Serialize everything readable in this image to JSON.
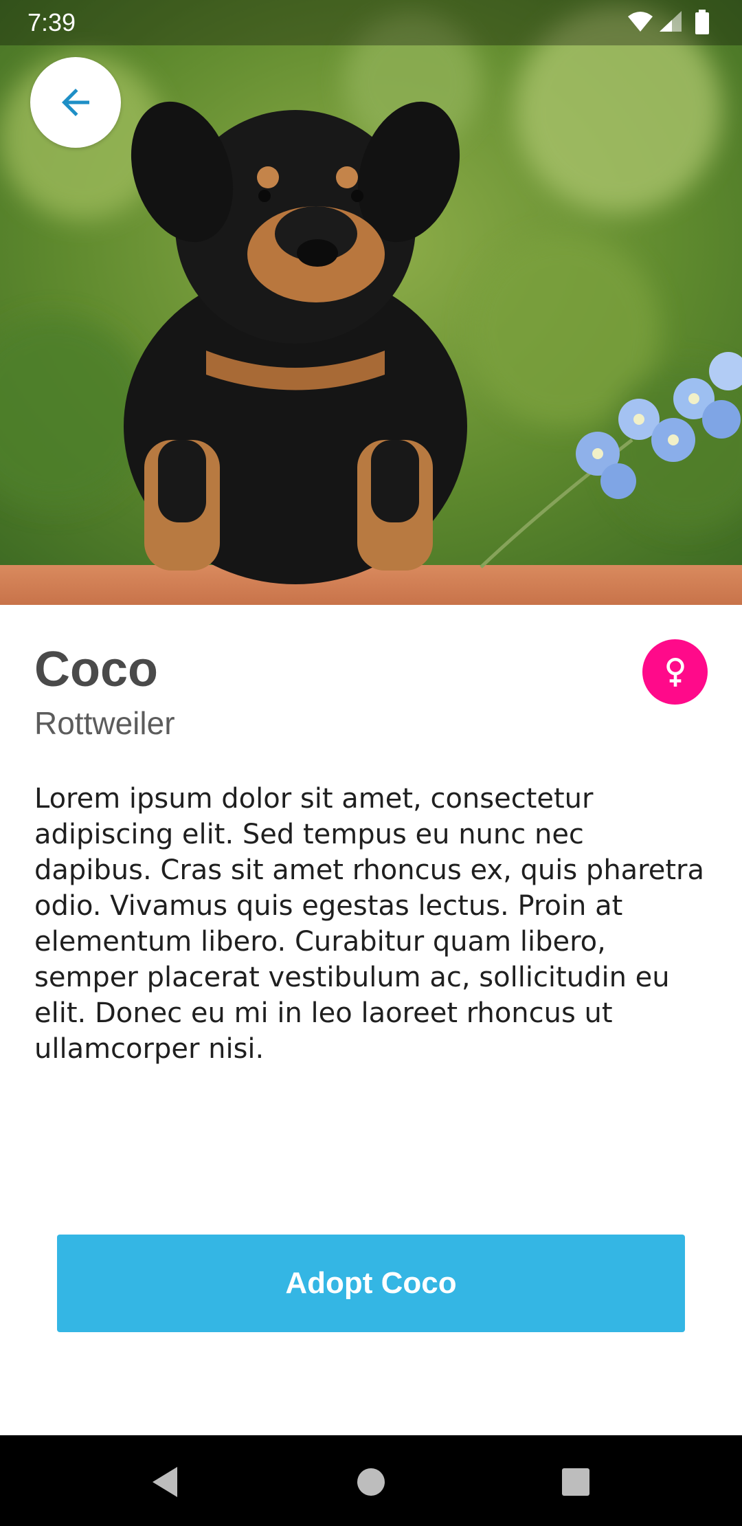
{
  "status_bar": {
    "time": "7:39",
    "icons": [
      "wifi-icon",
      "cell-signal-icon",
      "battery-icon"
    ]
  },
  "hero": {
    "subject": "puppy-photo"
  },
  "back_button": {
    "icon": "arrow-left-icon",
    "color": "#1e8fc6"
  },
  "pet": {
    "name": "Coco",
    "breed": "Rottweiler",
    "gender_icon": "female-icon",
    "gender_color": "#ff0a8a",
    "description": "Lorem ipsum dolor sit amet, consectetur adipiscing elit. Sed tempus eu nunc nec dapibus. Cras sit amet rhoncus ex, quis pharetra odio. Vivamus quis egestas lectus. Proin at elementum libero. Curabitur quam libero, semper placerat vestibulum ac, sollicitudin eu elit. Donec eu mi in leo laoreet rhoncus ut ullamcorper nisi."
  },
  "adopt_button": {
    "label": "Adopt Coco",
    "color": "#34b6e4"
  },
  "nav_bar": {
    "icons": [
      "back-triangle-icon",
      "home-circle-icon",
      "recents-square-icon"
    ]
  }
}
